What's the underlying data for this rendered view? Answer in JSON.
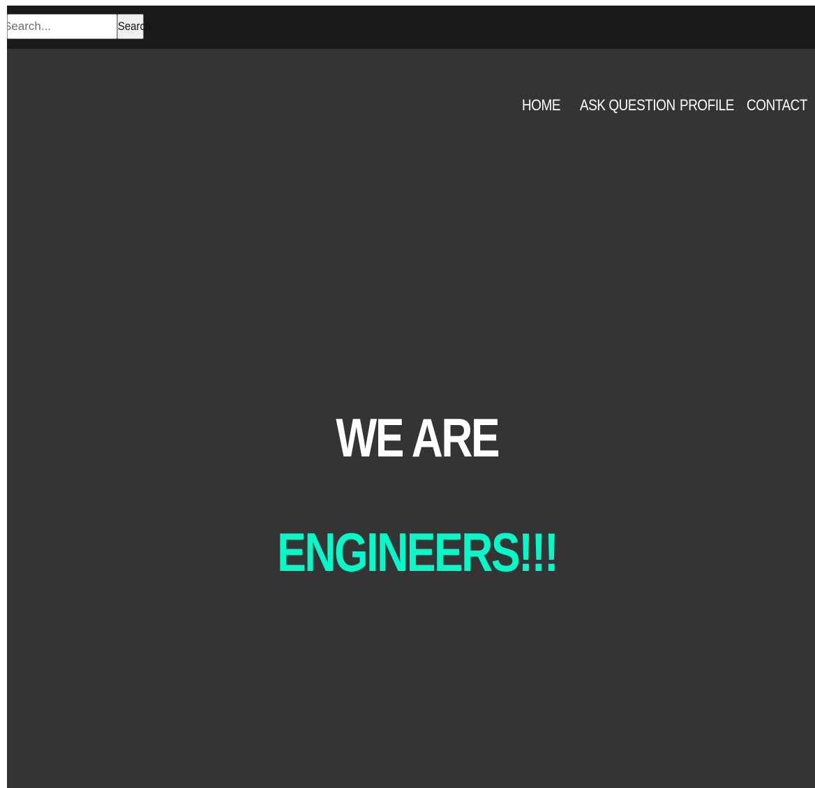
{
  "search": {
    "placeholder": "Search...",
    "button_label": "Search"
  },
  "nav": {
    "items": [
      {
        "label": "HOME"
      },
      {
        "label": "ASK QUESTION"
      },
      {
        "label": "PROFILE"
      },
      {
        "label": "CONTACT"
      }
    ]
  },
  "hero": {
    "line1": "WE ARE",
    "line2": "ENGINEERS!!!"
  },
  "colors": {
    "topbar": "#1a1a1c",
    "background": "#343434",
    "accent": "#05f9c8",
    "text": "#ffffff"
  }
}
